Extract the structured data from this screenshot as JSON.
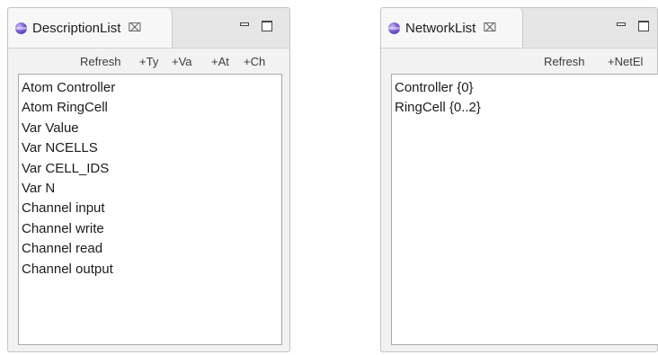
{
  "left_view": {
    "tab_title": "DescriptionList",
    "close_glyph": "⌧",
    "toolbar": [
      "Refresh",
      "+Ty",
      "+Va",
      "+At",
      "+Ch"
    ],
    "items": [
      "Atom Controller",
      "Atom RingCell",
      "Var Value",
      "Var NCELLS",
      "Var CELL_IDS",
      "Var N",
      "Channel input",
      "Channel write",
      "Channel read",
      "Channel output"
    ]
  },
  "right_view": {
    "tab_title": "NetworkList",
    "close_glyph": "⌧",
    "toolbar": [
      "Refresh",
      "+NetEl"
    ],
    "items": [
      "Controller {0}",
      "RingCell {0..2}"
    ]
  },
  "icons": {
    "view_icon": "purple-sphere-icon",
    "close": "close-icon",
    "minimize": "minimize-icon",
    "maximize": "maximize-icon"
  }
}
